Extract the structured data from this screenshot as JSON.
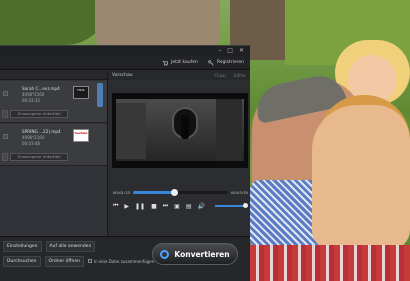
{
  "window": {
    "controls": [
      "–",
      "□",
      "✕"
    ]
  },
  "toolbar": {
    "buy_now": "Jetzt kaufen",
    "register": "Registrieren"
  },
  "preview": {
    "title": "Vorschau",
    "btn_clip": "Clipar",
    "btn_edit": "Editar"
  },
  "files": [
    {
      "name": "Sarah C...ex).mp4",
      "resolution": "4096*2160",
      "duration": "00:03:35",
      "thumb": "HSTA",
      "subtitle": "Erzwungene Untertitel"
    },
    {
      "name": "SPRING ...22).mp4",
      "resolution": "4096*2160",
      "duration": "00:03:48",
      "thumb": "YouTube",
      "subtitle": "Erzwungene Untertitel"
    }
  ],
  "player": {
    "current_time": "00:01:23",
    "total_time": "00:03:35",
    "progress": 0.43
  },
  "bottom": {
    "settings": "Einstellungen",
    "apply_all": "Auf alle anwenden",
    "browse": "Durchsuchen",
    "open_folder": "Ordner öffnen",
    "merge": "In eine Datei zusammenfügen",
    "convert": "Konvertieren"
  },
  "colors": {
    "accent": "#3a86d8",
    "panel": "#2a2c2f"
  }
}
